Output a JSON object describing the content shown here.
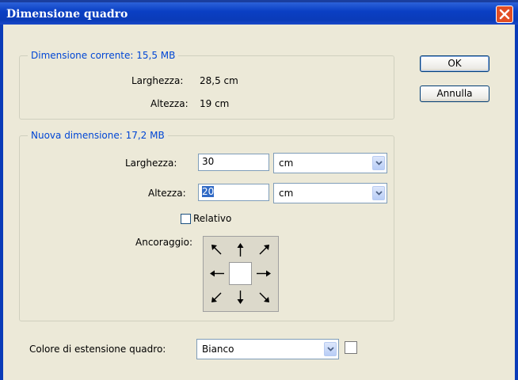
{
  "window": {
    "title": "Dimensione quadro"
  },
  "current": {
    "legend": "Dimensione corrente: 15,5 MB",
    "width_label": "Larghezza:",
    "width_value": "28,5 cm",
    "height_label": "Altezza:",
    "height_value": "19 cm"
  },
  "new": {
    "legend": "Nuova dimensione: 17,2 MB",
    "width_label": "Larghezza:",
    "width_value": "30",
    "width_unit": "cm",
    "height_label": "Altezza:",
    "height_value": "20",
    "height_unit": "cm",
    "relative_label": "Relativo",
    "relative_checked": false,
    "anchor_label": "Ancoraggio:",
    "anchor_selected": "center"
  },
  "extension": {
    "label": "Colore di estensione quadro:",
    "value": "Bianco",
    "swatch_color": "#ffffff"
  },
  "buttons": {
    "ok": "OK",
    "cancel": "Annulla"
  }
}
